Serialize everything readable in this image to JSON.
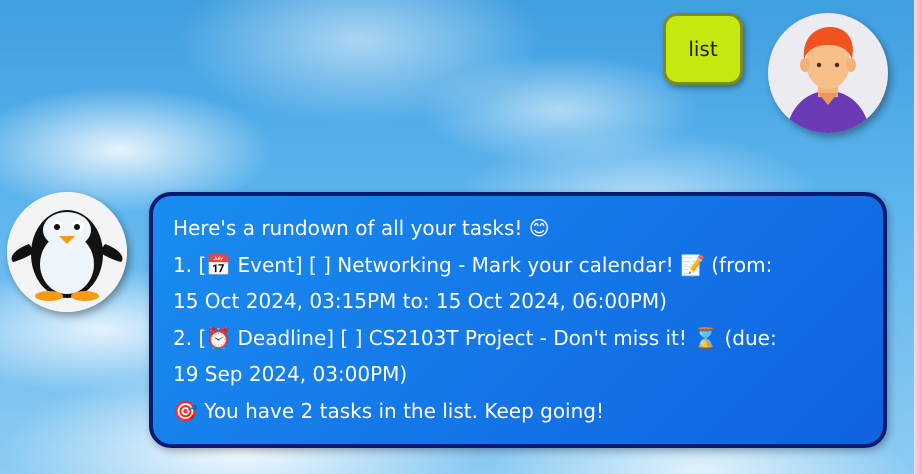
{
  "user_message": {
    "text": "list"
  },
  "bot_message": {
    "lines": [
      "Here's a rundown of all your tasks! 😊",
      "1. [📅 Event] [ ] Networking  - Mark your calendar! 📝 (from:",
      "15 Oct 2024, 03:15PM to: 15 Oct 2024, 06:00PM)",
      "2. [⏰ Deadline] [ ] CS2103T Project  - Don't miss it! ⌛ (due:",
      "19 Sep 2024, 03:00PM)",
      "🎯 You have 2 tasks in the list. Keep going!"
    ]
  },
  "colors": {
    "user_bubble": "#c5e80f",
    "bot_bubble": "#1477e8",
    "bot_border": "#0a1a70"
  },
  "icons": {
    "user_avatar": "person-avatar-icon",
    "bot_avatar": "penguin-avatar-icon"
  }
}
